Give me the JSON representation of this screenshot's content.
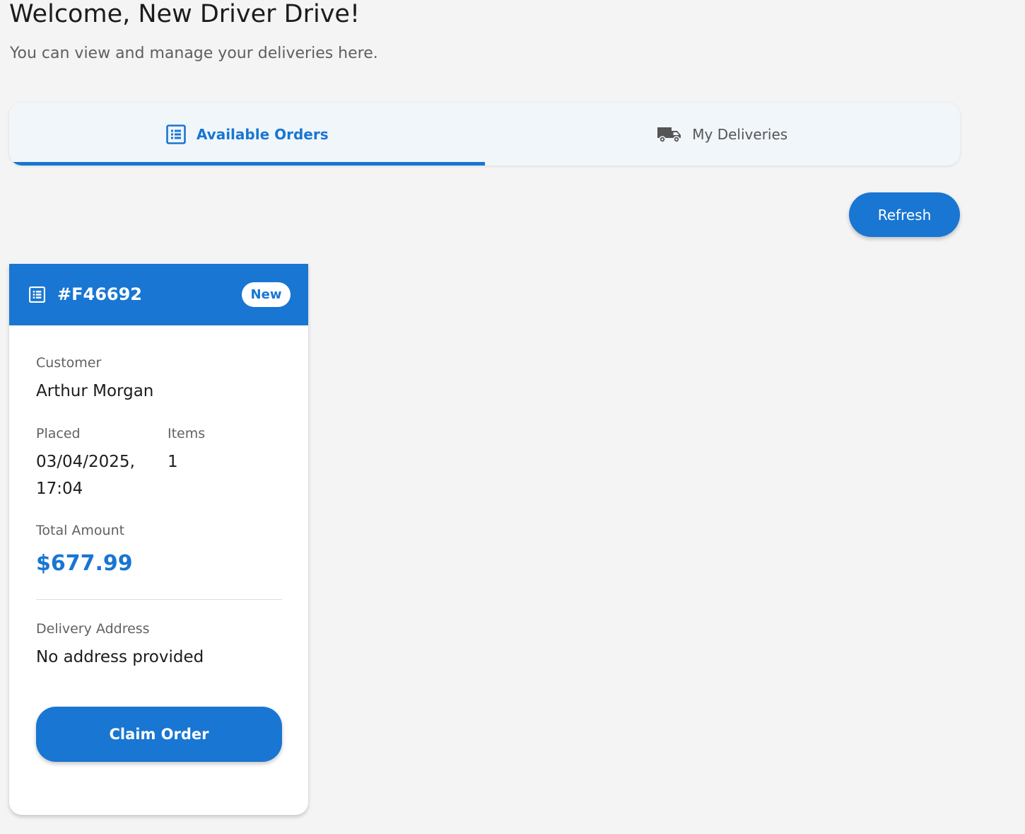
{
  "header": {
    "title": "Welcome, New Driver Drive!",
    "subtitle": "You can view and manage your deliveries here."
  },
  "tabs": [
    {
      "label": "Available Orders",
      "icon": "order-list-icon",
      "active": true
    },
    {
      "label": "My Deliveries",
      "icon": "truck-icon",
      "active": false
    }
  ],
  "toolbar": {
    "refresh_label": "Refresh"
  },
  "orders": [
    {
      "id": "#F46692",
      "status": "New",
      "icon": "order-list-icon",
      "customer_label": "Customer",
      "customer": "Arthur Morgan",
      "placed_label": "Placed",
      "placed": "03/04/2025, 17:04",
      "items_label": "Items",
      "items": "1",
      "total_label": "Total Amount",
      "total": "$677.99",
      "address_label": "Delivery Address",
      "address": "No address provided",
      "claim_label": "Claim Order"
    }
  ],
  "colors": {
    "primary": "#1976d2",
    "background": "#f4f4f4",
    "tab_bar": "#f1f6fb",
    "card": "#ffffff",
    "text_muted": "#616161"
  }
}
